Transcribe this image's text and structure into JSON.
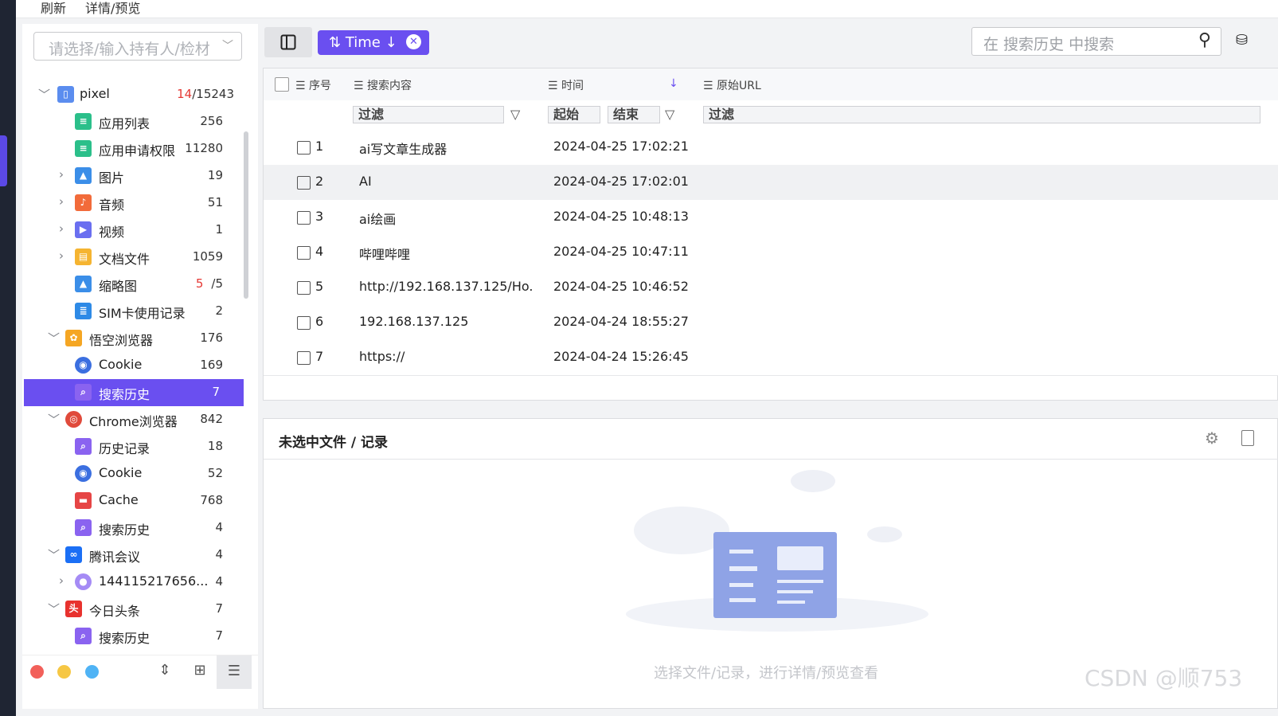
{
  "topbar": {
    "items": [
      "刷新",
      "详情/预览"
    ]
  },
  "sidebar": {
    "selector_placeholder": "请选择/输入持有人/检材",
    "tree": [
      {
        "label": "pixel",
        "count_hl": "14",
        "count": "/15243",
        "icon": "phone-doc-icon",
        "expand": "open"
      },
      {
        "label": "应用列表",
        "count": "256",
        "icon": "list-icon"
      },
      {
        "label": "应用申请权限",
        "count": "11280",
        "icon": "list-icon"
      },
      {
        "label": "图片",
        "count": "19",
        "icon": "image-icon",
        "expand": "closed"
      },
      {
        "label": "音频",
        "count": "51",
        "icon": "audio-icon",
        "expand": "closed"
      },
      {
        "label": "视频",
        "count": "1",
        "icon": "video-icon",
        "expand": "closed"
      },
      {
        "label": "文档文件",
        "count": "1059",
        "icon": "document-icon",
        "expand": "closed"
      },
      {
        "label": "缩略图",
        "count_hl": "5",
        "count": "/5",
        "icon": "image-icon"
      },
      {
        "label": "SIM卡使用记录",
        "count": "2",
        "icon": "sim-icon"
      },
      {
        "label": "悟空浏览器",
        "count": "176",
        "icon": "wukong-browser-icon",
        "expand": "open"
      },
      {
        "label": "Cookie",
        "count": "169",
        "icon": "cookie-globe-icon"
      },
      {
        "label": "搜索历史",
        "count": "7",
        "icon": "search-history-icon",
        "selected": true
      },
      {
        "label": "Chrome浏览器",
        "count": "842",
        "icon": "chrome-icon",
        "expand": "open"
      },
      {
        "label": "历史记录",
        "count": "18",
        "icon": "history-icon"
      },
      {
        "label": "Cookie",
        "count": "52",
        "icon": "cookie-globe-icon"
      },
      {
        "label": "Cache",
        "count": "768",
        "icon": "cache-icon"
      },
      {
        "label": "搜索历史",
        "count": "4",
        "icon": "search-history-icon"
      },
      {
        "label": "腾讯会议",
        "count": "4",
        "icon": "tencent-meeting-icon",
        "expand": "open"
      },
      {
        "label": "144115217656...",
        "count": "4",
        "icon": "user-avatar-icon",
        "expand": "closed"
      },
      {
        "label": "今日头条",
        "count": "7",
        "icon": "toutiao-icon",
        "expand": "open"
      },
      {
        "label": "搜索历史",
        "count": "7",
        "icon": "search-history-icon"
      }
    ]
  },
  "toolbar": {
    "panel_icon": "panel-toggle-icon",
    "sort_label": "Time",
    "search_placeholder": "在 搜索历史 中搜索"
  },
  "grid": {
    "columns": [
      "序号",
      "搜索内容",
      "时间",
      "原始URL"
    ],
    "filters": {
      "content": "过滤",
      "start": "起始",
      "end": "结束",
      "url": "过滤"
    },
    "rows": [
      {
        "no": "1",
        "content": "ai写文章生成器",
        "time": "2024-04-25 17:02:21"
      },
      {
        "no": "2",
        "content": "AI",
        "time": "2024-04-25 17:02:01"
      },
      {
        "no": "3",
        "content": "ai绘画",
        "time": "2024-04-25 10:48:13"
      },
      {
        "no": "4",
        "content": "哔哩哔哩",
        "time": "2024-04-25 10:47:11"
      },
      {
        "no": "5",
        "content": "http://192.168.137.125/Ho...",
        "time": "2024-04-25 10:46:52"
      },
      {
        "no": "6",
        "content": "192.168.137.125",
        "time": "2024-04-24 18:55:27"
      },
      {
        "no": "7",
        "content": "https://",
        "time": "2024-04-24 15:26:45"
      }
    ]
  },
  "detail": {
    "title": "未选中文件 / 记录",
    "hint": "选择文件/记录，进行详情/预览查看"
  },
  "colors": {
    "accent": "#6a4ff0",
    "highlight_count": "#e53935"
  },
  "watermark": "CSDN @顺753"
}
